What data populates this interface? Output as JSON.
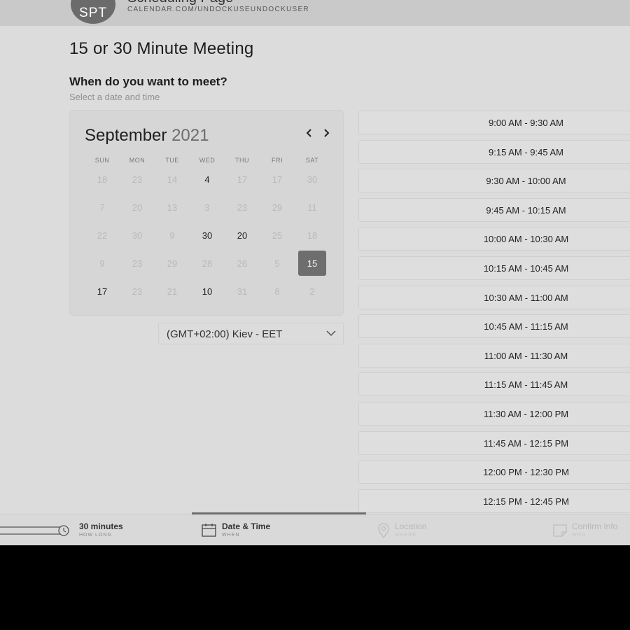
{
  "header": {
    "avatar_initials": "SPT",
    "page_name": "Scheduling Page",
    "url": "CALENDAR.COM/UNDOCKUSEUNDOCKUSER"
  },
  "event": {
    "title": "15 or 30 Minute Meeting",
    "question": "When do you want to meet?",
    "subtitle": "Select a date and time"
  },
  "calendar": {
    "month": "September",
    "year": "2021",
    "prev_icon": "‹",
    "next_icon": "›",
    "weekdays": [
      "SUN",
      "MON",
      "TUE",
      "WED",
      "THU",
      "FRI",
      "SAT"
    ],
    "weeks": [
      [
        "18",
        "23",
        "14",
        "4",
        "17",
        "17",
        "30"
      ],
      [
        "7",
        "20",
        "13",
        "3",
        "23",
        "29",
        "11"
      ],
      [
        "22",
        "30",
        "9",
        "30",
        "20",
        "25",
        "18"
      ],
      [
        "9",
        "23",
        "29",
        "28",
        "26",
        "5",
        "15"
      ],
      [
        "17",
        "23",
        "21",
        "10",
        "31",
        "8",
        "2"
      ]
    ],
    "selected_day": "15"
  },
  "timezone": {
    "value": "(GMT+02:00) Kiev - EET"
  },
  "slots": [
    "9:00 AM - 9:30 AM",
    "9:15 AM - 9:45 AM",
    "9:30 AM - 10:00 AM",
    "9:45 AM - 10:15 AM",
    "10:00 AM - 10:30 AM",
    "10:15 AM - 10:45 AM",
    "10:30 AM - 11:00 AM",
    "10:45 AM - 11:15 AM",
    "11:00 AM - 11:30 AM",
    "11:15 AM - 11:45 AM",
    "11:30 AM - 12:00 PM",
    "11:45 AM - 12:15 PM",
    "12:00 PM - 12:30 PM",
    "12:15 PM - 12:45 PM"
  ],
  "steps": [
    {
      "label": "30 minutes",
      "sub": "HOW LONG",
      "icon": "clock-icon"
    },
    {
      "label": "Date & Time",
      "sub": "WHEN",
      "icon": "calendar-icon"
    },
    {
      "label": "Location",
      "sub": "WHERE",
      "icon": "location-pin-icon"
    },
    {
      "label": "Confirm Info",
      "sub": "WHO",
      "icon": "note-icon"
    }
  ],
  "colors": {
    "accent": "#6e6e6e",
    "background": "#dcdcdc"
  }
}
